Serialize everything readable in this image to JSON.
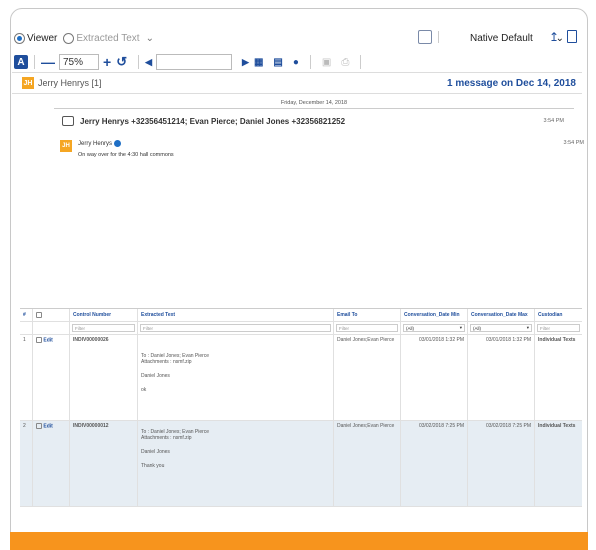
{
  "toolbar": {
    "viewer_label": "Viewer",
    "extracted_label": "Extracted Text",
    "native_default": "Native Default",
    "zoom": "75%"
  },
  "conversation": {
    "header_name": "Jerry Henrys [1]",
    "avatar_initials": "JH",
    "message_count": "1 message on Dec 14, 2018",
    "date": "Friday, December 14, 2018",
    "participants": "Jerry Henrys +32356451214; Evan Pierce; Daniel Jones +32356821252",
    "participants_time": "3:54 PM",
    "sender": "Jerry Henrys",
    "sender_time": "3:54 PM",
    "message": "On way over for the 4:30 hall commons"
  },
  "grid": {
    "headers": [
      "#",
      "",
      "Control Number",
      "Extracted Text",
      "Email To",
      "Conversation_Date Min",
      "Conversation_Date Max",
      "Custodian"
    ],
    "filter_placeholder": "Filter",
    "filter_all": "(All)",
    "rows": [
      {
        "num": "1",
        "edit": "Edit",
        "control": "INDIV00000026",
        "text_to": "To : Daniel Jones; Evan Pierce",
        "text_att": "Attachments : nsmf.zip",
        "text_from": "Daniel Jones",
        "text_msg": "ok",
        "email_to": "Daniel Jones;Evan Pierce",
        "date_min": "03/01/2018 1:32 PM",
        "date_max": "03/01/2018 1:32 PM",
        "custodian": "Individual Texts"
      },
      {
        "num": "2",
        "edit": "Edit",
        "control": "INDIV00000012",
        "text_to": "To : Daniel Jones; Evan Pierce",
        "text_att": "Attachments : nsmf.zip",
        "text_from": "Daniel Jones",
        "text_msg": "Thank you",
        "email_to": "Daniel Jones;Evan Pierce",
        "date_min": "03/02/2018 7:25 PM",
        "date_max": "03/02/2018 7:25 PM",
        "custodian": "Individual Texts"
      }
    ]
  },
  "colors": {
    "accent": "#1f4e9c",
    "orange": "#f7941d",
    "avatar": "#f5a623"
  }
}
